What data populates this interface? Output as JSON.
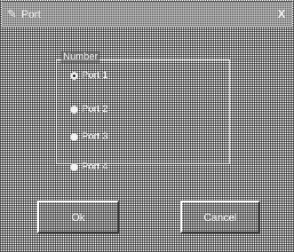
{
  "window": {
    "title": "Port",
    "app_icon": "pencil-icon",
    "close_glyph": "X"
  },
  "group": {
    "label": "Number",
    "options": [
      {
        "label": "Port 1",
        "checked": true
      },
      {
        "label": "Port 2",
        "checked": false
      },
      {
        "label": "Port 3",
        "checked": false
      },
      {
        "label": "Port 4",
        "checked": false
      }
    ]
  },
  "buttons": {
    "ok_label": "Ok",
    "cancel_label": "Cancel"
  }
}
